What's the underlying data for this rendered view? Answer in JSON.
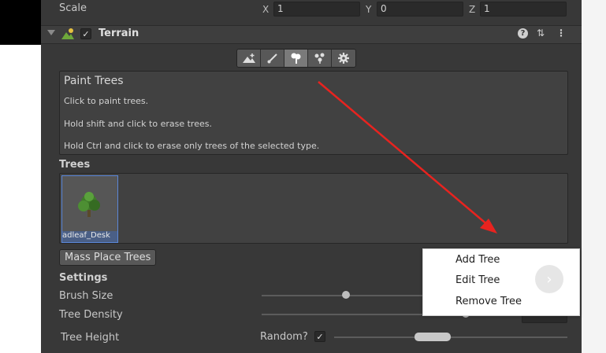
{
  "transform": {
    "scale_label": "Scale",
    "x_label": "X",
    "x_value": "1",
    "y_label": "Y",
    "y_value": "0",
    "z_label": "Z",
    "z_value": "1"
  },
  "component": {
    "title": "Terrain",
    "enabled": true,
    "help_icon": "?",
    "preset_icon": "⇅",
    "more_icon": "⋮"
  },
  "toolbar": {
    "tools": [
      {
        "name": "raise-terrain-icon",
        "active": false
      },
      {
        "name": "paint-brush-icon",
        "active": false
      },
      {
        "name": "paint-trees-icon",
        "active": true
      },
      {
        "name": "paint-details-icon",
        "active": false
      },
      {
        "name": "settings-gear-icon",
        "active": false
      }
    ]
  },
  "help": {
    "title": "Paint Trees",
    "lines": [
      "Click to paint trees.",
      "Hold shift and click to erase trees.",
      "Hold Ctrl and click to erase only trees of the selected type."
    ]
  },
  "trees": {
    "label": "Trees",
    "items": [
      {
        "name": "adleaf_Desk"
      }
    ],
    "mass_place_label": "Mass Place Trees"
  },
  "settings": {
    "label": "Settings",
    "brush_size_label": "Brush Size",
    "tree_density_label": "Tree Density",
    "tree_height_label": "Tree Height",
    "random_label": "Random?",
    "random_checked": true,
    "check_glyph": "✓"
  },
  "context_menu": {
    "items": [
      "Add Tree",
      "Edit Tree",
      "Remove Tree"
    ],
    "arrow_glyph": "›"
  },
  "colors": {
    "panel_bg": "#383838",
    "selection": "#5b87d8",
    "annotation_arrow": "#e8231f"
  }
}
